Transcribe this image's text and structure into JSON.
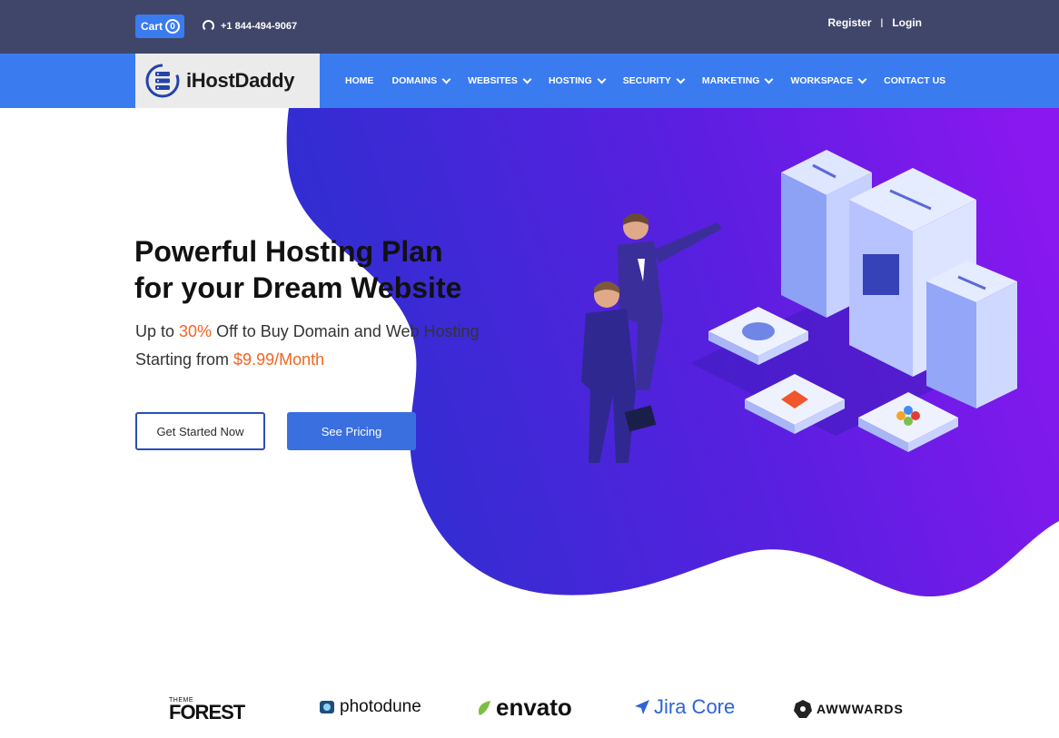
{
  "topbar": {
    "cart_label": "Cart",
    "cart_count": "0",
    "phone": "+1 844-494-9067",
    "register": "Register",
    "separator": "|",
    "login": "Login"
  },
  "brand": {
    "name": "iHostDaddy"
  },
  "nav": {
    "items": [
      {
        "label": "HOME",
        "dropdown": false
      },
      {
        "label": "DOMAINS",
        "dropdown": true
      },
      {
        "label": "WEBSITES",
        "dropdown": true
      },
      {
        "label": "HOSTING",
        "dropdown": true
      },
      {
        "label": "SECURITY",
        "dropdown": true
      },
      {
        "label": "MARKETING",
        "dropdown": true
      },
      {
        "label": "WORKSPACE",
        "dropdown": true
      },
      {
        "label": "CONTACT US",
        "dropdown": false
      }
    ]
  },
  "hero": {
    "title_line1": "Powerful Hosting Plan",
    "title_line2": "for your Dream Website",
    "sub1_pre": "Up to ",
    "sub1_hl": "30%",
    "sub1_post": " Off to Buy Domain and Web Hosting",
    "sub2_pre": "Starting from ",
    "sub2_hl": "$9.99/Month",
    "cta_primary": "Get Started Now",
    "cta_secondary": "See Pricing"
  },
  "partners": {
    "themeforest_small": "THEME",
    "themeforest_big": "FOREST",
    "photodune": "photodune",
    "envato": "envato",
    "jira": "Jira Core",
    "awwwards": "AWWWARDS"
  },
  "colors": {
    "topbar": "#3f4669",
    "navbar": "#3a7bf0",
    "accent": "#f26522",
    "gradient_start": "#2d2fd0",
    "gradient_end": "#8a17f0"
  }
}
